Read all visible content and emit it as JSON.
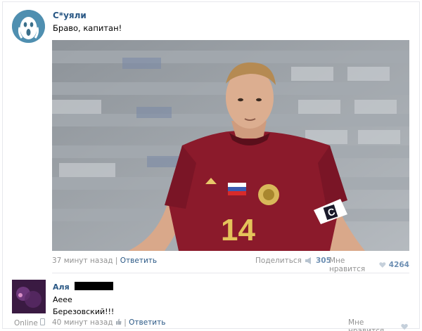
{
  "post": {
    "author": "С*уяли",
    "text": "Браво, капитан!",
    "time": "37 минут назад",
    "separator": "|",
    "reply_label": "Ответить",
    "share_label": "Поделиться",
    "share_count": "305",
    "like_label": "Мне нравится",
    "like_count": "4264",
    "photo": {
      "jersey_number": "14",
      "armband_letter": "C"
    }
  },
  "comment": {
    "author": "Аля",
    "line1": "Аеее",
    "line2": "Березовский!!!",
    "online": "Online",
    "time": "40 минут назад",
    "separator": "|",
    "reply_label": "Ответить",
    "like_label": "Мне нравится"
  },
  "colors": {
    "link": "#2a5885",
    "muted": "#939393",
    "count": "#6d8fb3",
    "jersey": "#8b1a2b"
  },
  "icons": [
    "scream-avatar-icon",
    "megaphone-icon",
    "heart-icon",
    "phone-icon",
    "thumb-icon"
  ]
}
